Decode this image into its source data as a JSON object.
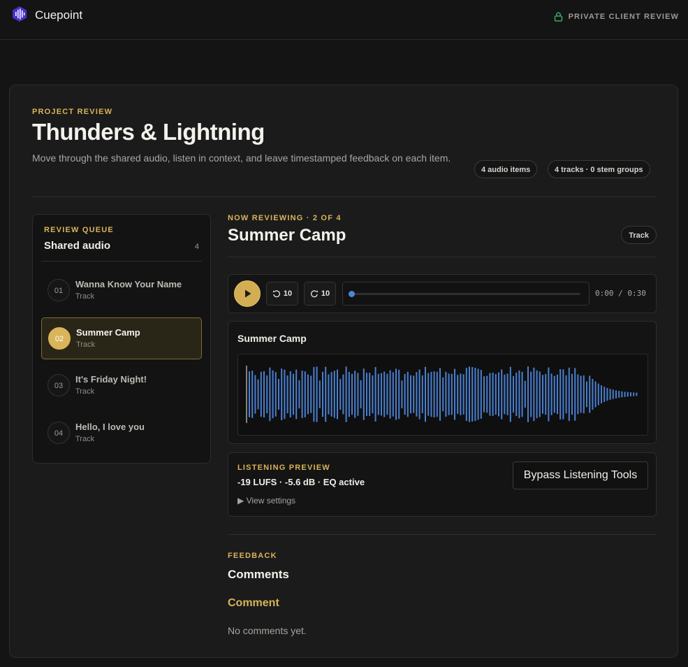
{
  "app": {
    "name": "Cuepoint",
    "badge": "PRIVATE CLIENT REVIEW"
  },
  "project": {
    "eyebrow": "PROJECT REVIEW",
    "title": "Thunders & Lightning",
    "description": "Move through the shared audio, listen in context, and leave timestamped feedback on each item.",
    "pills": [
      "4 audio items",
      "4 tracks · 0 stem groups"
    ]
  },
  "queue": {
    "eyebrow": "REVIEW QUEUE",
    "title": "Shared audio",
    "count": "4",
    "items": [
      {
        "num": "01",
        "name": "Wanna Know Your Name",
        "type": "Track"
      },
      {
        "num": "02",
        "name": "Summer Camp",
        "type": "Track"
      },
      {
        "num": "03",
        "name": "It's Friday Night!",
        "type": "Track"
      },
      {
        "num": "04",
        "name": "Hello, I love you",
        "type": "Track"
      }
    ],
    "active_index": 1
  },
  "now": {
    "eyebrow": "NOW REVIEWING · 2 OF 4",
    "title": "Summer Camp",
    "badge": "Track"
  },
  "player": {
    "skip_back": "10",
    "skip_forward": "10",
    "time": "0:00 / 0:30",
    "progress": 0
  },
  "waveform": {
    "title": "Summer Camp",
    "color": "#4a7fd0"
  },
  "preview": {
    "eyebrow": "LISTENING PREVIEW",
    "stats": "-19 LUFS · -5.6 dB · EQ active",
    "settings": "▶ View settings",
    "bypass_label": "Bypass Listening Tools"
  },
  "feedback": {
    "eyebrow": "FEEDBACK",
    "title": "Comments",
    "comment_label": "Comment",
    "empty": "No comments yet."
  },
  "colors": {
    "accent": "#d9b45a",
    "blue": "#4d86d6",
    "bg": "#141414"
  }
}
